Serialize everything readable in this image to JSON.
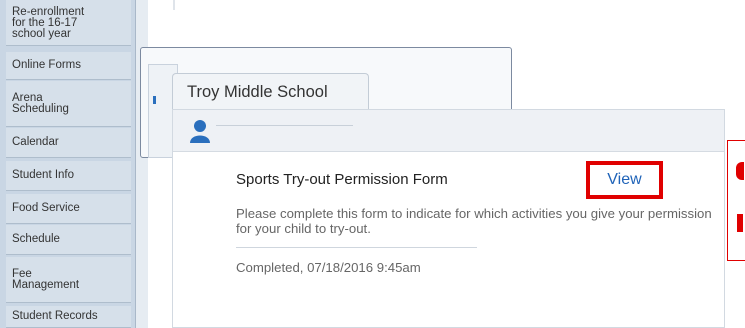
{
  "sidebar": {
    "items": [
      {
        "label_lines": [
          "Re-enrollment",
          "for the 16-17",
          "school year"
        ]
      },
      {
        "label_lines": [
          "Online Forms"
        ]
      },
      {
        "label_lines": [
          "Arena",
          "Scheduling"
        ]
      },
      {
        "label_lines": [
          "Calendar"
        ]
      },
      {
        "label_lines": [
          "Student Info"
        ]
      },
      {
        "label_lines": [
          "Food Service"
        ]
      },
      {
        "label_lines": [
          "Schedule"
        ]
      },
      {
        "label_lines": [
          "Fee",
          "Management"
        ]
      },
      {
        "label_lines": [
          "Student Records"
        ]
      }
    ]
  },
  "main": {
    "school_tab": "Troy Middle School",
    "form": {
      "title": "Sports Try-out Permission Form",
      "view_label": "View",
      "description": "Please complete this form to indicate for which activities you give your permission for your child to try-out.",
      "status": "Completed, 07/18/2016 9:45am"
    }
  },
  "icons": {
    "person": "person-icon"
  },
  "colors": {
    "sidebar": "#c9d6e4",
    "link": "#1f63b8",
    "highlight": "#e00000"
  }
}
